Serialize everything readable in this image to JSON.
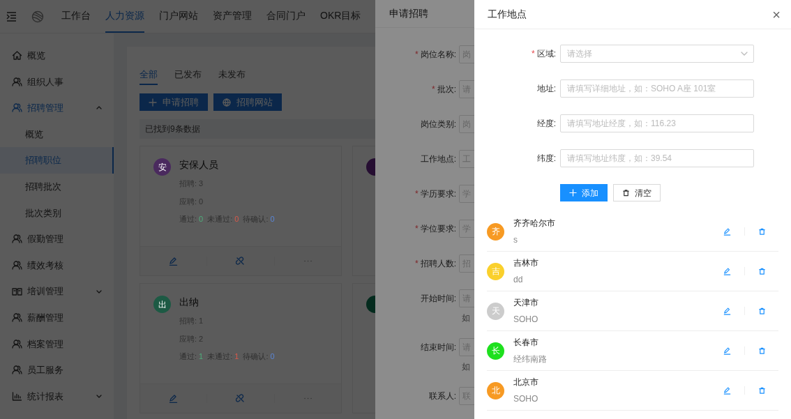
{
  "top_nav": {
    "items": [
      {
        "label": "工作台",
        "selected": false
      },
      {
        "label": "人力资源",
        "selected": true
      },
      {
        "label": "门户网站",
        "selected": false
      },
      {
        "label": "资产管理",
        "selected": false
      },
      {
        "label": "合同门户",
        "selected": false
      },
      {
        "label": "OKR目标",
        "selected": false
      }
    ]
  },
  "sidebar": {
    "items": [
      {
        "label": "概览",
        "kind": "home",
        "selected": false
      },
      {
        "label": "组织人事",
        "kind": "user",
        "selected": false
      },
      {
        "label": "招聘管理",
        "kind": "user",
        "selected": true,
        "expanded": true,
        "children": [
          {
            "label": "概览",
            "selected": false
          },
          {
            "label": "招聘职位",
            "selected": true
          },
          {
            "label": "招聘批次",
            "selected": false
          },
          {
            "label": "批次类别",
            "selected": false
          }
        ]
      },
      {
        "label": "假勤管理",
        "kind": "user",
        "selected": false
      },
      {
        "label": "绩效考核",
        "kind": "user",
        "selected": false
      },
      {
        "label": "培训管理",
        "kind": "book",
        "selected": false,
        "expanded": false
      },
      {
        "label": "薪酬管理",
        "kind": "user",
        "selected": false
      },
      {
        "label": "档案管理",
        "kind": "user",
        "selected": false
      },
      {
        "label": "员工服务",
        "kind": "user",
        "selected": false
      },
      {
        "label": "统计报表",
        "kind": "chart",
        "selected": false,
        "expanded": false
      }
    ]
  },
  "content": {
    "tabs": [
      {
        "label": "全部",
        "selected": true
      },
      {
        "label": "已发布",
        "selected": false
      },
      {
        "label": "未发布",
        "selected": false
      }
    ],
    "buttons": [
      {
        "label": "申请招聘",
        "kind": "plus"
      },
      {
        "label": "招聘网站",
        "kind": "globe"
      }
    ],
    "result_text": "已找到9条数据",
    "cards": [
      {
        "avatar": "安",
        "color": "#4a2a5e",
        "title": "安保人员",
        "lines": [
          "招聘: 3",
          "应聘: 0"
        ],
        "stats": [
          {
            "label": "通过:",
            "value": "0",
            "kind": "pass"
          },
          {
            "label": "未通过:",
            "value": "0",
            "kind": "fail"
          },
          {
            "label": "待确认:",
            "value": "0",
            "kind": "pending"
          }
        ]
      },
      {
        "avatar": "出",
        "color": "#1d5a44",
        "title": "出纳",
        "lines": [
          "招聘: 1",
          "应聘: 2"
        ],
        "stats": [
          {
            "label": "通过:",
            "value": "1",
            "kind": "pass"
          },
          {
            "label": "未通过:",
            "value": "1",
            "kind": "fail"
          },
          {
            "label": "待确认:",
            "value": "0",
            "kind": "pending"
          }
        ]
      }
    ]
  },
  "apply_drawer": {
    "title": "申请招聘",
    "fields": [
      {
        "label": "岗位名称:",
        "required_mark": "*",
        "placeholder": "岗"
      },
      {
        "label": "批次:",
        "required_mark": "*",
        "placeholder": "请"
      },
      {
        "label": "岗位类别:",
        "placeholder": "岗"
      },
      {
        "label": "工作地点:",
        "placeholder": "工"
      },
      {
        "label": "学历要求:",
        "required_mark": "*",
        "placeholder": "学"
      },
      {
        "label": "学位要求:",
        "required_mark": "*",
        "placeholder": "学"
      },
      {
        "label": "招聘人数:",
        "required_mark": "*",
        "placeholder": "招"
      },
      {
        "label": "开始时间:",
        "placeholder": "请",
        "hint": "如"
      },
      {
        "label": "结束时间:",
        "placeholder": "请",
        "hint": "如"
      },
      {
        "label": "联系人:",
        "placeholder": "联"
      }
    ]
  },
  "location_drawer": {
    "title": "工作地点",
    "close": "×",
    "fields": [
      {
        "label": "区域:",
        "required_mark": "*",
        "kind": "select",
        "placeholder": "请选择"
      },
      {
        "label": "地址:",
        "kind": "text",
        "placeholder": "请填写详细地址，如：SOHO A座 101室"
      },
      {
        "label": "经度:",
        "kind": "text",
        "placeholder": "请填写地址经度，如：116.23"
      },
      {
        "label": "纬度:",
        "kind": "text",
        "placeholder": "请填写地址纬度，如：39.54"
      }
    ],
    "buttons": [
      {
        "label": "添加",
        "kind": "primary"
      },
      {
        "label": "清空",
        "kind": "default"
      }
    ],
    "locations": [
      {
        "avatar": "齐",
        "color": "#f79a23",
        "name": "齐齐哈尔市",
        "address": "s"
      },
      {
        "avatar": "吉",
        "color": "#fad02c",
        "name": "吉林市",
        "address": "dd"
      },
      {
        "avatar": "天",
        "color": "#cccccc",
        "name": "天津市",
        "address": "SOHO"
      },
      {
        "avatar": "长",
        "color": "#1ee01e",
        "name": "长春市",
        "address": "经纬南路"
      },
      {
        "avatar": "北",
        "color": "#f79a23",
        "name": "北京市",
        "address": "SOHO"
      }
    ]
  }
}
